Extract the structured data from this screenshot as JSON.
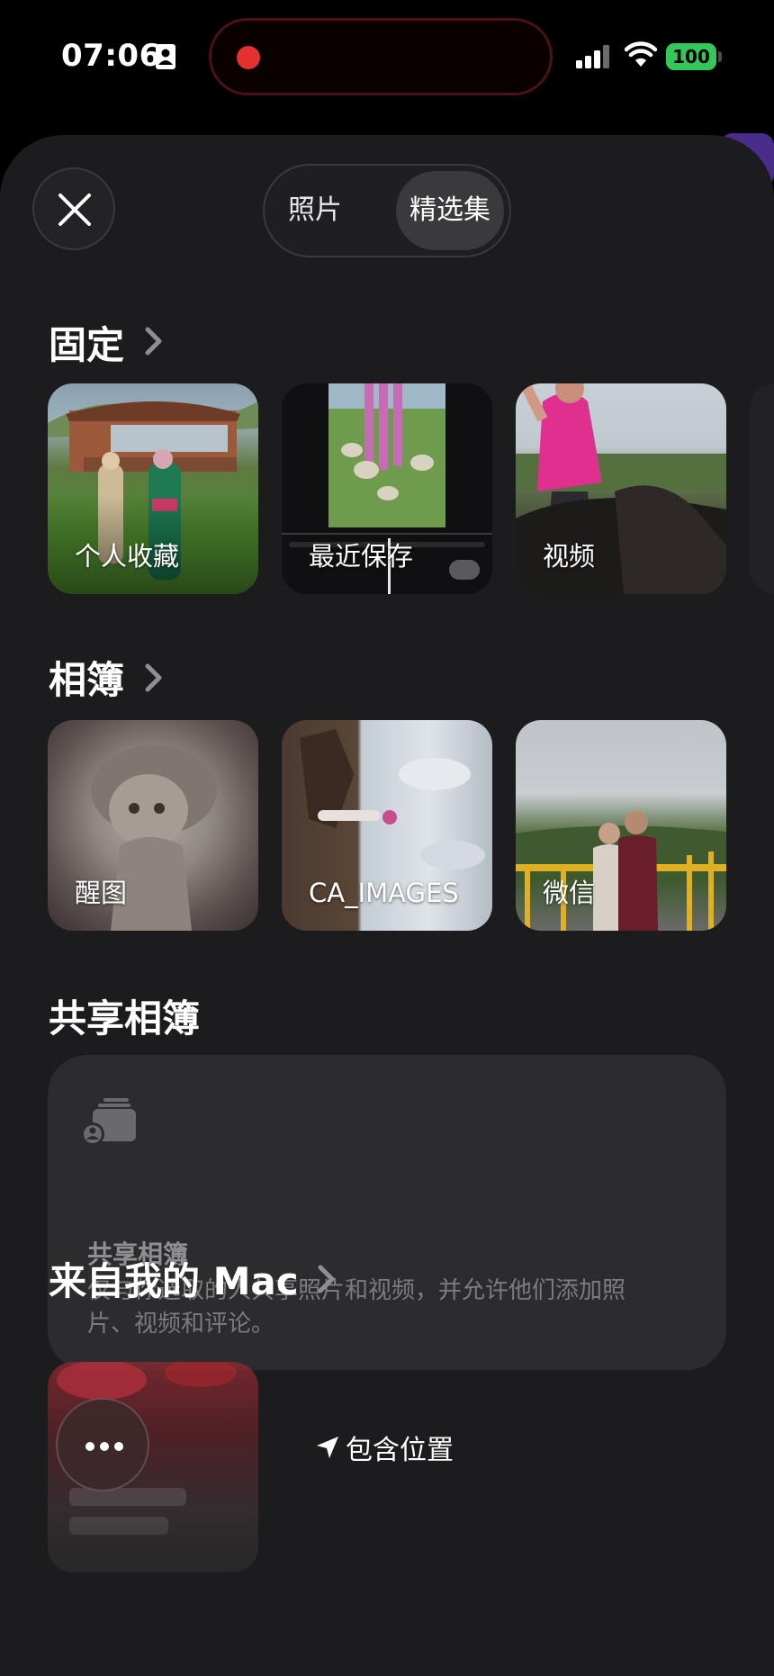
{
  "status_bar": {
    "time": "07:06",
    "battery": "100",
    "colors": {
      "battery": "#35c759",
      "recording": "#e53030"
    }
  },
  "header": {
    "close_icon": "close-icon",
    "segments": [
      "照片",
      "精选集"
    ],
    "selected_segment": "精选集"
  },
  "pinned": {
    "title": "固定",
    "items": [
      {
        "label": "个人收藏"
      },
      {
        "label": "最近保存"
      },
      {
        "label": "视频"
      }
    ]
  },
  "albums": {
    "title": "相簿",
    "items": [
      {
        "label": "醒图"
      },
      {
        "label": "CA_IMAGES"
      },
      {
        "label": "微信"
      }
    ]
  },
  "shared_albums": {
    "title": "共享相簿",
    "card_title": "共享相簿",
    "card_description": "仅与你选取的人共享照片和视频，并允许他们添加照片、视频和评论。"
  },
  "from_my_mac": {
    "title": "来自我的 Mac"
  },
  "bottom_bar": {
    "more_icon": "more-icon",
    "location_label": "包含位置"
  }
}
